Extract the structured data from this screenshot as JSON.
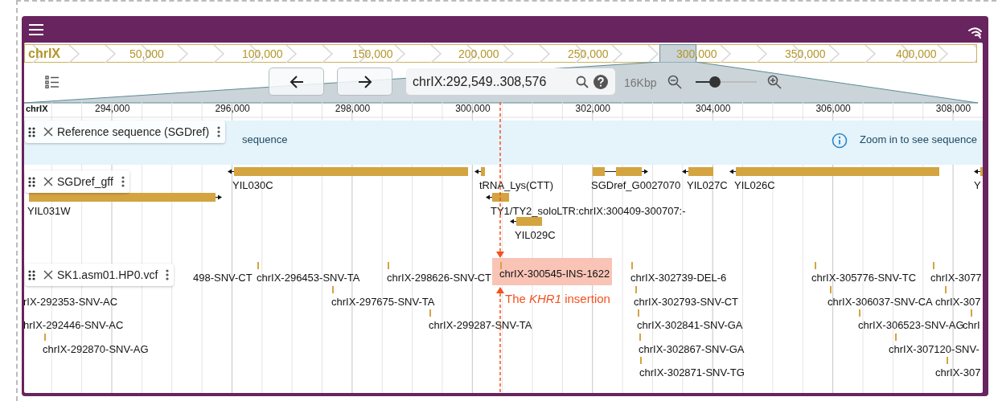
{
  "overview": {
    "chromosome": "chrIX",
    "ticks": [
      "50,000",
      "100,000",
      "150,000",
      "200,000",
      "250,000",
      "300,000",
      "350,000",
      "400,000"
    ]
  },
  "navigation": {
    "location": "chrIX:292,549..308,576",
    "scale": "16Kbp",
    "zoom": {
      "level": 0.32
    }
  },
  "ruler": {
    "chromosome": "chrIX",
    "ticks": [
      "294,000",
      "296,000",
      "298,000",
      "300,000",
      "302,000",
      "304,000",
      "306,000",
      "308,000"
    ]
  },
  "tracks": [
    {
      "kind": "sequence",
      "name": "Reference sequence (SGDref)",
      "messages": [
        "sequence",
        "Zoom in to see sequence"
      ]
    },
    {
      "kind": "features",
      "name": "SGDref_gff",
      "features": [
        {
          "label": "YIL031W",
          "reverse_strand": false,
          "kind": "simple"
        },
        {
          "label": "YIL030C",
          "reverse_strand": true,
          "kind": "simple"
        },
        {
          "label": "tRNA_Lys(CTT)",
          "reverse_strand": true,
          "kind": "simple"
        },
        {
          "label": "TY1/TY2_soloLTR:chrIX:300409-300707:-",
          "reverse_strand": true,
          "kind": "simple"
        },
        {
          "label": "YIL029C",
          "reverse_strand": true,
          "kind": "simple"
        },
        {
          "label": "SGDref_G0027070",
          "reverse_strand": false,
          "kind": "spliced"
        },
        {
          "label": "YIL027C",
          "reverse_strand": true,
          "kind": "simple"
        },
        {
          "label": "YIL026C",
          "reverse_strand": true,
          "kind": "simple"
        },
        {
          "label": "Y",
          "reverse_strand": true,
          "kind": "simple"
        }
      ]
    },
    {
      "kind": "variants",
      "name": "SK1.asm01.HP0.vcf",
      "variants": [
        {
          "label": "498-SNV-CT",
          "highlighted": false
        },
        {
          "label": "chrIX-296453-SNV-TA",
          "highlighted": false
        },
        {
          "label": "chrIX-298626-SNV-CT",
          "highlighted": false
        },
        {
          "label": "chrIX-300545-INS-1622",
          "highlighted": true
        },
        {
          "label": "chrIX-302739-DEL-6",
          "highlighted": false
        },
        {
          "label": "chrIX-305776-SNV-TC",
          "highlighted": false
        },
        {
          "label": "chrIX-3077",
          "highlighted": false
        },
        {
          "label": "rIX-292353-SNV-AC",
          "highlighted": false
        },
        {
          "label": "chrIX-297675-SNV-TA",
          "highlighted": false
        },
        {
          "label": "chrIX-302793-SNV-CT",
          "highlighted": false
        },
        {
          "label": "chrIX-306037-SNV-CA",
          "highlighted": false
        },
        {
          "label": "chrIX-307",
          "highlighted": false
        },
        {
          "label": "hrIX-292446-SNV-AC",
          "highlighted": false
        },
        {
          "label": "chrIX-299287-SNV-TA",
          "highlighted": false
        },
        {
          "label": "chrIX-302841-SNV-GA",
          "highlighted": false
        },
        {
          "label": "chrIX-306523-SNV-AG",
          "highlighted": false
        },
        {
          "label": "chrI",
          "highlighted": false
        },
        {
          "label": "chrIX-292870-SNV-AG",
          "highlighted": false
        },
        {
          "label": "chrIX-302867-SNV-GA",
          "highlighted": false
        },
        {
          "label": "chrIX-307120-SNV-",
          "highlighted": false
        },
        {
          "label": "chrIX-302871-SNV-TG",
          "highlighted": false
        },
        {
          "label": "chrIX-307",
          "highlighted": false
        }
      ]
    }
  ],
  "annotation": {
    "text": "The *KHR1* insertion"
  }
}
